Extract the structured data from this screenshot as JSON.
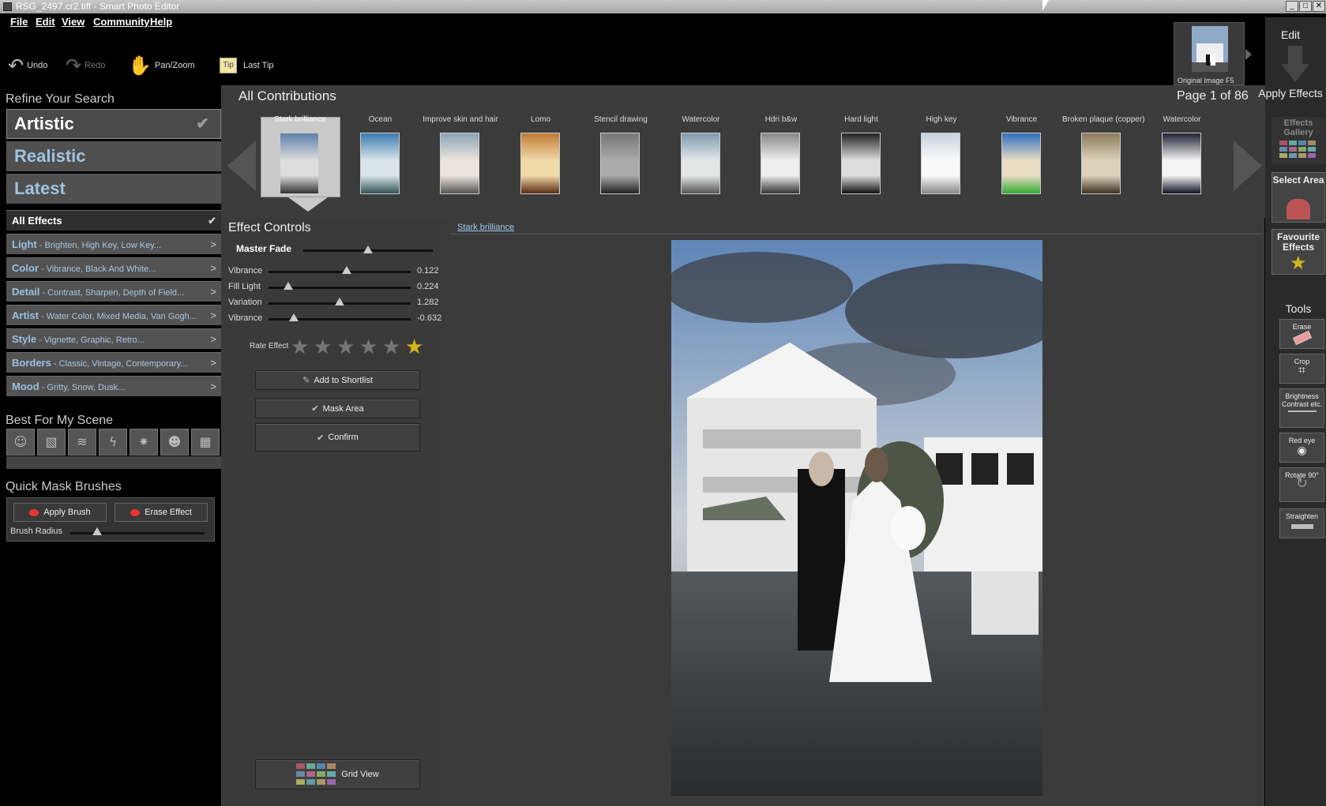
{
  "window": {
    "title": "RSG_2497.cr2.tiff - Smart Photo Editor",
    "min": "_",
    "max": "□",
    "close": "✕"
  },
  "menu": [
    "File",
    "Edit",
    "View",
    "Community",
    "Help"
  ],
  "toolbar": {
    "undo": "Undo",
    "redo": "Redo",
    "panzoom": "Pan/Zoom",
    "lasttip": "Last Tip"
  },
  "original": {
    "label": "Original Image F5"
  },
  "right": {
    "edit": "Edit",
    "apply": "Apply Effects",
    "gallery": "Effects Gallery",
    "select": "Select Area",
    "favourite": "Favourite Effects",
    "tools": "Tools"
  },
  "tools": [
    "Erase",
    "Crop",
    "Brightness Contrast etc.",
    "Red eye",
    "Rotate 90°",
    "Straighten"
  ],
  "left": {
    "refine_title": "Refine Your Search",
    "modes": [
      "Artistic",
      "Realistic",
      "Latest"
    ],
    "all_effects": "All Effects",
    "categories": [
      {
        "name": "Light",
        "desc": " - Brighten, High Key, Low Key..."
      },
      {
        "name": "Color",
        "desc": " - Vibrance, Black And White..."
      },
      {
        "name": "Detail",
        "desc": " - Contrast, Sharpen, Depth of Field..."
      },
      {
        "name": "Artist",
        "desc": " - Water Color, Mixed Media, Van Gogh..."
      },
      {
        "name": "Style",
        "desc": " - Vignette, Graphic, Retro..."
      },
      {
        "name": "Borders",
        "desc": " - Classic, Vintage, Contemporary..."
      },
      {
        "name": "Mood",
        "desc": " - Gritty, Snow, Dusk..."
      }
    ],
    "best_title": "Best For My Scene",
    "mask_title": "Quick Mask Brushes",
    "apply_brush": "Apply Brush",
    "erase_effect": "Erase Effect",
    "brush_radius": "Brush Radius"
  },
  "contrib": {
    "title": "All Contributions",
    "page": "Page 1 of 86",
    "items": [
      "Stark brilliance",
      "Ocean",
      "Improve skin and hair",
      "Lomo",
      "Stencil drawing",
      "Watercolor",
      "Hdri b&w",
      "Hard light",
      "High key",
      "Vibrance",
      "Broken plaque (copper)",
      "Watercolor"
    ]
  },
  "controls": {
    "title": "Effect Controls",
    "master": "Master Fade",
    "master_level": 0.5,
    "sliders": [
      {
        "label": "Vibrance",
        "value": "0.122",
        "pos": 0.55
      },
      {
        "label": "Fill Light",
        "value": "0.224",
        "pos": 0.14
      },
      {
        "label": "Variation",
        "value": "1.282",
        "pos": 0.5
      },
      {
        "label": "Vibrance",
        "value": "-0.632",
        "pos": 0.18
      }
    ],
    "rate_label": "Rate Effect",
    "rating": 1,
    "add_shortlist": "Add to Shortlist",
    "mask_area": "Mask Area",
    "confirm": "Confirm",
    "grid_view": "Grid View"
  },
  "viewer": {
    "effect_link": "Stark brilliance"
  }
}
